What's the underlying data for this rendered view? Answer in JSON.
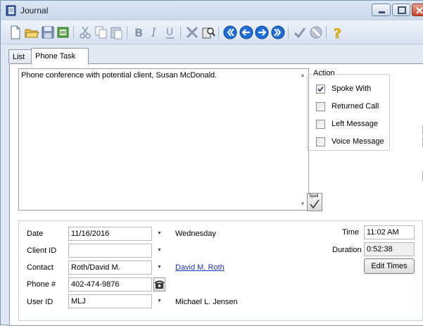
{
  "window": {
    "title": "Journal"
  },
  "toolbar": {
    "buttons": [
      {
        "name": "new-icon"
      },
      {
        "name": "open-folder-icon"
      },
      {
        "name": "save-icon"
      },
      {
        "name": "notes-icon"
      },
      {
        "name": "cut-icon"
      },
      {
        "name": "copy-icon"
      },
      {
        "name": "paste-icon"
      },
      {
        "name": "bold-icon"
      },
      {
        "name": "italic-icon"
      },
      {
        "name": "underline-icon"
      },
      {
        "name": "tools-icon"
      },
      {
        "name": "search-book-icon"
      },
      {
        "name": "first-record-icon"
      },
      {
        "name": "previous-record-icon"
      },
      {
        "name": "next-record-icon"
      },
      {
        "name": "last-record-icon"
      },
      {
        "name": "check-icon"
      },
      {
        "name": "cancel-icon"
      },
      {
        "name": "help-icon"
      }
    ]
  },
  "tabs": [
    {
      "label": "List",
      "active": false
    },
    {
      "label": "Phone Task",
      "active": true
    }
  ],
  "notes": {
    "text": "Phone conference with potential client, Susan McDonald."
  },
  "action": {
    "legend": "Action",
    "items": [
      {
        "label": "Spoke With",
        "checked": true
      },
      {
        "label": "Returned Call",
        "checked": false
      },
      {
        "label": "Left Message",
        "checked": false
      },
      {
        "label": "Voice Message",
        "checked": false
      }
    ]
  },
  "spell": {
    "label": "Spell"
  },
  "form": {
    "date": {
      "label": "Date",
      "value": "11/16/2016",
      "weekday": "Wednesday"
    },
    "client": {
      "label": "Client ID",
      "value": ""
    },
    "contact": {
      "label": "Contact",
      "value": "Roth/David M.",
      "link": "David M. Roth"
    },
    "phone": {
      "label": "Phone #",
      "value": "402-474-9876"
    },
    "user": {
      "label": "User ID",
      "value": "MLJ",
      "name": "Michael L. Jensen"
    },
    "time": {
      "label": "Time",
      "value": "11:02 AM"
    },
    "duration": {
      "label": "Duration",
      "value": "0:52:38"
    },
    "edit_times_label": "Edit Times"
  },
  "colors": {
    "accent_blue": "#1e6fd9",
    "link": "#1a35c8",
    "help_yellow": "#f2c318"
  }
}
